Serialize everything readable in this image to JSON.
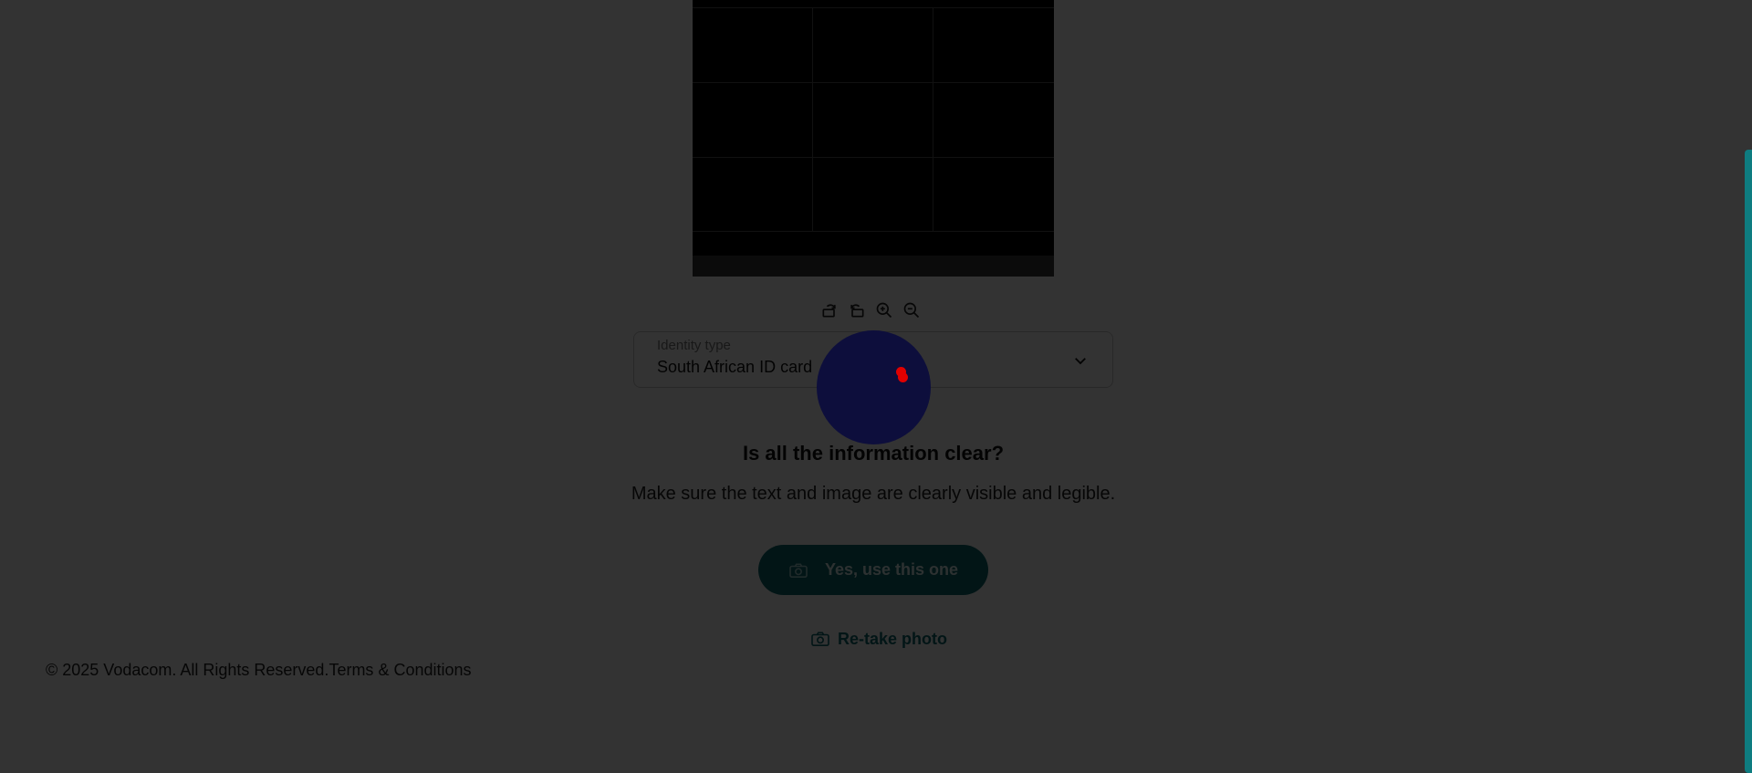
{
  "toolbar": {
    "icons": [
      "rotate-right-icon",
      "rotate-left-icon",
      "zoom-in-icon",
      "zoom-out-icon"
    ]
  },
  "identity_select": {
    "label": "Identity type",
    "value": "South African ID card"
  },
  "confirm": {
    "heading": "Is all the information clear?",
    "subtext": "Make sure the text and image are clearly visible and legible.",
    "primary_label": "Yes, use this one",
    "retake_label": "Re-take photo"
  },
  "footer": {
    "copyright": "© 2025 Vodacom. All Rights Reserved.",
    "terms": "Terms & Conditions"
  },
  "colors": {
    "accent": "#0b6b70",
    "spinner_bg": "#0d0e3c",
    "spinner_dot": "#e00000",
    "overlay": "rgba(0,0,0,0.8)"
  }
}
